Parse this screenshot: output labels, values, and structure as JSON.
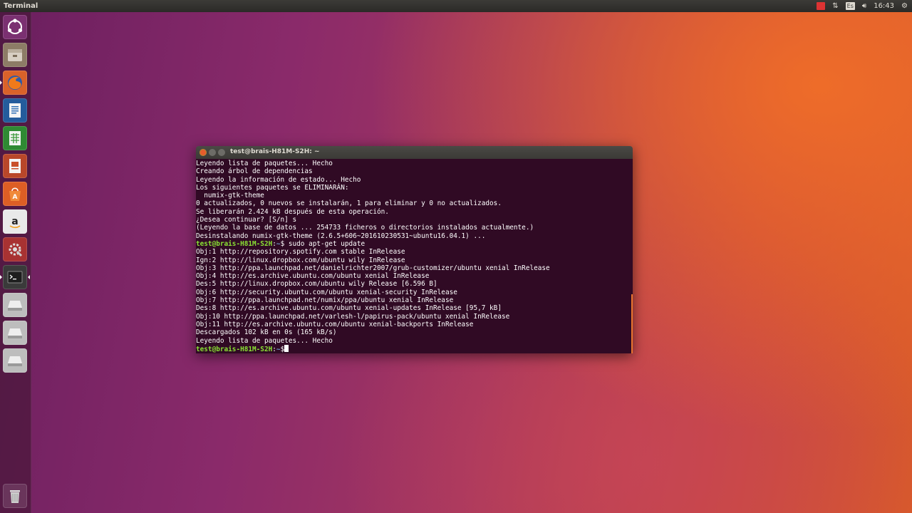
{
  "top_panel": {
    "app_title": "Terminal",
    "keyboard_layout": "Es",
    "clock": "16:43"
  },
  "launcher": {
    "items": [
      {
        "name": "dash-icon",
        "color": "#6a2a62"
      },
      {
        "name": "files-icon",
        "color": "#9e8b72"
      },
      {
        "name": "firefox-icon",
        "color": "#e66a1f"
      },
      {
        "name": "writer-icon",
        "color": "#2f6fb5"
      },
      {
        "name": "calc-icon",
        "color": "#3d9a3d"
      },
      {
        "name": "impress-icon",
        "color": "#c9502a"
      },
      {
        "name": "software-center-icon",
        "color": "#e8672b"
      },
      {
        "name": "amazon-icon",
        "color": "#f2f2f2"
      },
      {
        "name": "settings-icon",
        "color": "#b83a3a"
      },
      {
        "name": "terminal-icon",
        "color": "#2c2c2c"
      },
      {
        "name": "drive-icon",
        "color": "#c8c8c8"
      },
      {
        "name": "drive-icon",
        "color": "#c8c8c8"
      },
      {
        "name": "drive-icon",
        "color": "#c8c8c8"
      }
    ],
    "trash": {
      "name": "trash-icon"
    }
  },
  "terminal": {
    "title": "test@brais-H81M-S2H: ~",
    "prompt_user": "test@brais-H81M-S2H",
    "prompt_sep": ":",
    "prompt_path": "~",
    "prompt_symbol": "$",
    "lines": [
      "Leyendo lista de paquetes... Hecho",
      "Creando árbol de dependencias",
      "Leyendo la información de estado... Hecho",
      "Los siguientes paquetes se ELIMINARÁN:",
      "  numix-gtk-theme",
      "0 actualizados, 0 nuevos se instalarán, 1 para eliminar y 0 no actualizados.",
      "Se liberarán 2.424 kB después de esta operación.",
      "¿Desea continuar? [S/n] s",
      "(Leyendo la base de datos ... 254733 ficheros o directorios instalados actualmente.)",
      "Desinstalando numix-gtk-theme (2.6.5+606~201610230531~ubuntu16.04.1) ..."
    ],
    "command_1": " sudo apt-get update",
    "lines_2": [
      "Obj:1 http://repository.spotify.com stable InRelease",
      "Ign:2 http://linux.dropbox.com/ubuntu wily InRelease",
      "Obj:3 http://ppa.launchpad.net/danielrichter2007/grub-customizer/ubuntu xenial InRelease",
      "Obj:4 http://es.archive.ubuntu.com/ubuntu xenial InRelease",
      "Des:5 http://linux.dropbox.com/ubuntu wily Release [6.596 B]",
      "Obj:6 http://security.ubuntu.com/ubuntu xenial-security InRelease",
      "Obj:7 http://ppa.launchpad.net/numix/ppa/ubuntu xenial InRelease",
      "Des:8 http://es.archive.ubuntu.com/ubuntu xenial-updates InRelease [95,7 kB]",
      "Obj:10 http://ppa.launchpad.net/varlesh-l/papirus-pack/ubuntu xenial InRelease",
      "Obj:11 http://es.archive.ubuntu.com/ubuntu xenial-backports InRelease",
      "Descargados 102 kB en 0s (165 kB/s)",
      "Leyendo lista de paquetes... Hecho"
    ]
  }
}
